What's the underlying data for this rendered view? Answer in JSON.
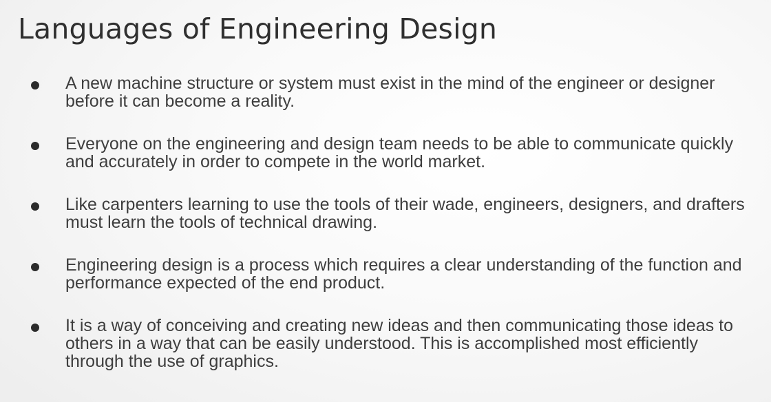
{
  "slide": {
    "title": "Languages of Engineering Design",
    "bullets": [
      "A new machine structure or system must exist in the mind of the engineer or designer before it can become a reality.",
      "Everyone on the engineering and design team needs to be able to communicate quickly and accurately in order to compete in the world market.",
      "Like carpenters learning to use the tools of their wade, engineers, designers, and drafters must learn the tools of technical drawing.",
      "Engineering design is a process which requires a clear understanding of the function and performance expected of the end product.",
      "It is a way of conceiving and creating new ideas and then communicating those ideas to others in a way that can be easily understood. This is accomplished most efficiently through the use of graphics."
    ]
  },
  "colors": {
    "title": "#2f2f2f",
    "body_text": "#3e3e3e",
    "bullet": "#2b2b2b",
    "background": "#f7f7f7"
  }
}
